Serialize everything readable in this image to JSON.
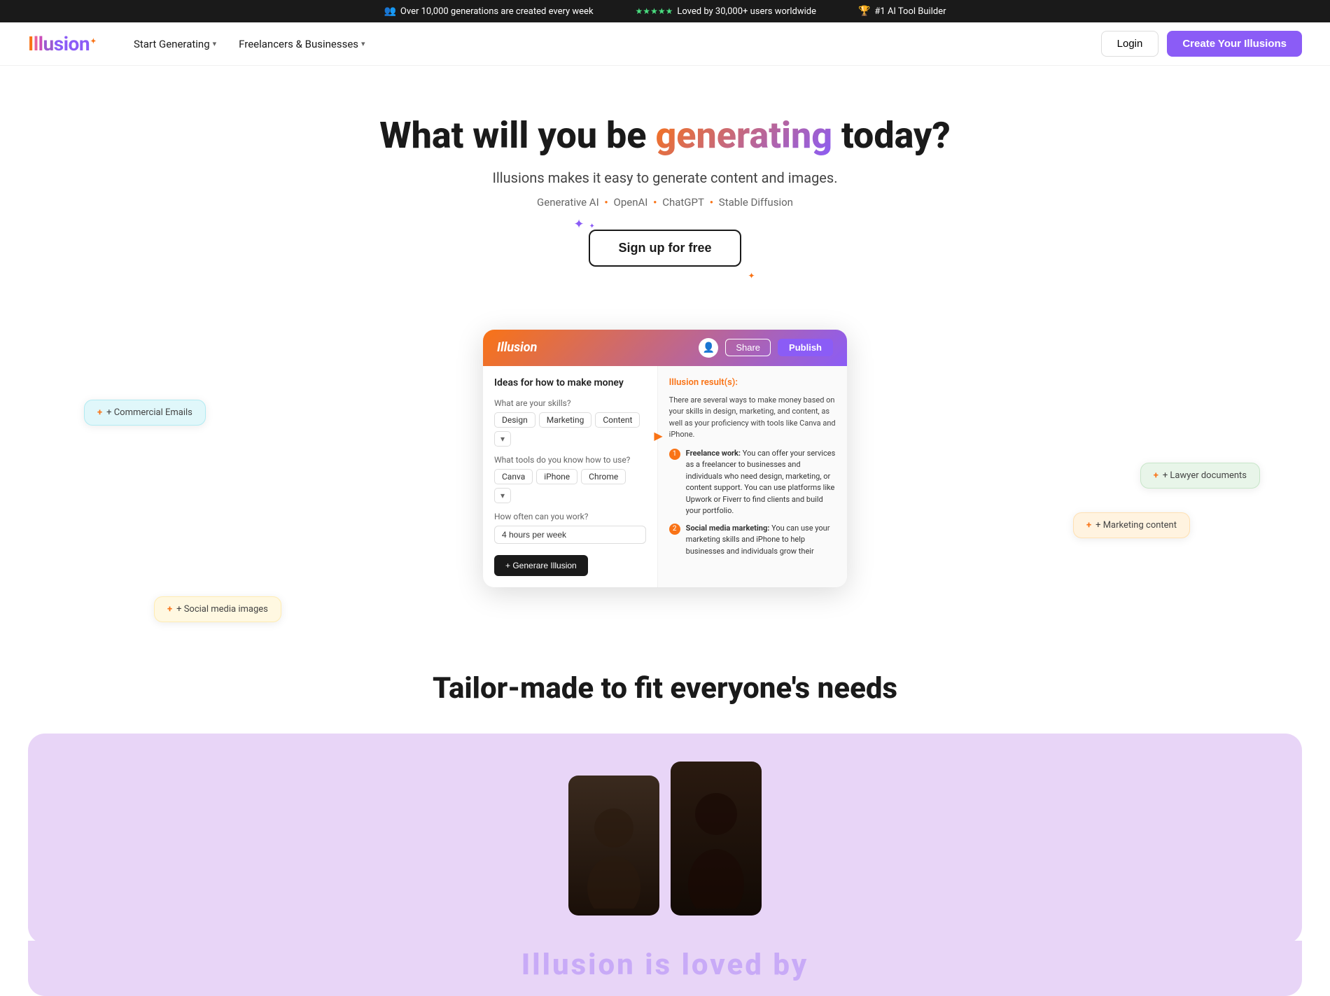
{
  "banner": {
    "item1": "Over 10,000 generations are created every week",
    "item2": "Loved by 30,000+ users worldwide",
    "item3": "#1 AI Tool Builder",
    "stars": "★★★★★"
  },
  "nav": {
    "logo": "Illusion",
    "links": [
      {
        "label": "Start Generating",
        "has_dropdown": true
      },
      {
        "label": "Freelancers & Businesses",
        "has_dropdown": true
      }
    ],
    "login_label": "Login",
    "cta_label": "Create Your Illusions"
  },
  "hero": {
    "title_prefix": "What will you be ",
    "title_highlight": "generating",
    "title_suffix": " today?",
    "subtitle": "Illusions makes it easy to generate content and images.",
    "tech_items": [
      "Generative AI",
      "OpenAI",
      "ChatGPT",
      "Stable Diffusion"
    ],
    "cta_label": "Sign up for free"
  },
  "demo": {
    "logo": "Illusion",
    "share_label": "Share",
    "publish_label": "Publish",
    "prompt": "Ideas for how to make money",
    "field1_label": "What are your skills?",
    "field1_tags": [
      "Design",
      "Marketing",
      "Content"
    ],
    "field2_label": "What tools do you know how to use?",
    "field2_tags": [
      "Canva",
      "iPhone",
      "Chrome"
    ],
    "field3_label": "How often can you work?",
    "field3_value": "4 hours per week",
    "generate_btn": "+ Generare Illusion",
    "result_title": "Illusion result(s):",
    "result_intro": "There are several ways to make money based on your skills in design, marketing, and content, as well as your proficiency with tools like Canva and iPhone.",
    "result_items": [
      {
        "num": "1",
        "title": "Freelance work:",
        "text": "You can offer your services as a freelancer to businesses and individuals who need design, marketing, or content support. You can use platforms like Upwork or Fiverr to find clients and build your portfolio."
      },
      {
        "num": "2",
        "title": "Social media marketing:",
        "text": "You can use your marketing skills and iPhone to help businesses and individuals grow their"
      }
    ]
  },
  "floating_cards": {
    "commercial": "+ Commercial Emails",
    "lawyer": "+ Lawyer documents",
    "marketing": "+ Marketing content",
    "social": "+ Social media images"
  },
  "tailor": {
    "title": "Tailor-made to fit everyone's needs"
  }
}
